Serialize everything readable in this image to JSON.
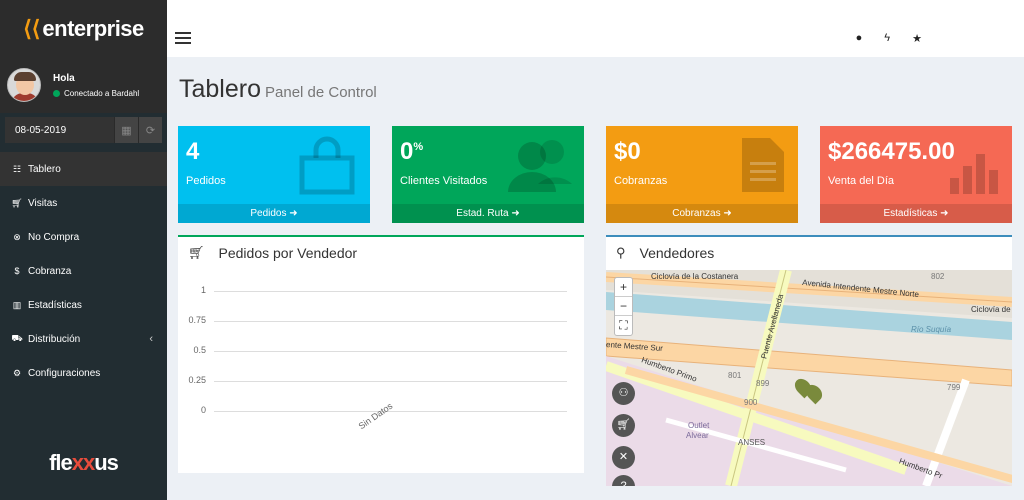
{
  "brand": {
    "logo": "enterprise",
    "bottom_logo_pre": "fle",
    "bottom_logo_mid": "xx",
    "bottom_logo_post": "us"
  },
  "user": {
    "greeting": "Hola",
    "status": "Conectado a Bardahl"
  },
  "date": {
    "value": "08-05-2019"
  },
  "menu": [
    {
      "label": "Tablero",
      "icon": "table-icon",
      "active": true
    },
    {
      "label": "Visitas",
      "icon": "cart-icon"
    },
    {
      "label": "No Compra",
      "icon": "times-circle-icon"
    },
    {
      "label": "Cobranza",
      "icon": "dollar-icon"
    },
    {
      "label": "Estadísticas",
      "icon": "bar-chart-icon"
    },
    {
      "label": "Distribución",
      "icon": "truck-icon"
    },
    {
      "label": "Configuraciones",
      "icon": "gear-icon"
    }
  ],
  "page": {
    "title": "Tablero",
    "subtitle": "Panel de Control"
  },
  "boxes": [
    {
      "value": "4",
      "label": "Pedidos",
      "footer": "Pedidos",
      "color": "#00c0ef",
      "icon": "shopping-bag-icon"
    },
    {
      "value": "0",
      "suffix": "%",
      "label": "Clientes Visitados",
      "footer": "Estad. Ruta",
      "color": "#00a65a",
      "icon": "users-icon"
    },
    {
      "value": "$0",
      "label": "Cobranzas",
      "footer": "Cobranzas",
      "color": "#f39c12",
      "icon": "document-icon"
    },
    {
      "value": "$266475.00",
      "label": "Venta del Día",
      "footer": "Estadísticas",
      "color": "#f56954",
      "icon": "bar-chart-icon"
    }
  ],
  "orders_panel": {
    "title": "Pedidos por Vendedor"
  },
  "sellers_panel": {
    "title": "Vendedores"
  },
  "chart_data": {
    "type": "bar",
    "categories": [
      "Sin Datos"
    ],
    "values": [
      0
    ],
    "title": "Pedidos por Vendedor",
    "yticks": [
      "1",
      "0.75",
      "0.5",
      "0.25",
      "0"
    ],
    "ylim": [
      0,
      1
    ]
  },
  "map": {
    "labels": [
      "Ciclovía de la Costanera",
      "Avenida Intendente Mestre Norte",
      "Ciclovía de",
      "Río Suquía",
      "Puente Avellaneda",
      "ente Mestre Sur",
      "Humberto Primo",
      "Outlet",
      "Alvear",
      "ANSES",
      "Humberto Pr",
      "802",
      "801",
      "899",
      "900",
      "799"
    ]
  }
}
